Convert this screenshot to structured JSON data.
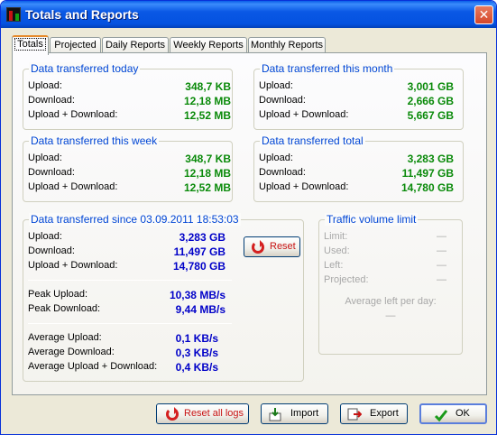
{
  "window": {
    "title": "Totals and Reports",
    "close": "✕"
  },
  "tabs": [
    {
      "label": "Totals"
    },
    {
      "label": "Projected"
    },
    {
      "label": "Daily Reports"
    },
    {
      "label": "Weekly Reports"
    },
    {
      "label": "Monthly Reports"
    }
  ],
  "today": {
    "title": "Data transferred today",
    "upload_label": "Upload:",
    "upload": "348,7 KB",
    "download_label": "Download:",
    "download": "12,18 MB",
    "both_label": "Upload + Download:",
    "both": "12,52 MB"
  },
  "month": {
    "title": "Data transferred this month",
    "upload_label": "Upload:",
    "upload": "3,001 GB",
    "download_label": "Download:",
    "download": "2,666 GB",
    "both_label": "Upload + Download:",
    "both": "5,667 GB"
  },
  "week": {
    "title": "Data transferred this week",
    "upload_label": "Upload:",
    "upload": "348,7 KB",
    "download_label": "Download:",
    "download": "12,18 MB",
    "both_label": "Upload + Download:",
    "both": "12,52 MB"
  },
  "total": {
    "title": "Data transferred total",
    "upload_label": "Upload:",
    "upload": "3,283 GB",
    "download_label": "Download:",
    "download": "11,497 GB",
    "both_label": "Upload + Download:",
    "both": "14,780 GB"
  },
  "since": {
    "title": "Data transferred since 03.09.2011 18:53:03",
    "upload_label": "Upload:",
    "upload": "3,283 GB",
    "download_label": "Download:",
    "download": "11,497 GB",
    "both_label": "Upload + Download:",
    "both": "14,780 GB",
    "peak_upload_label": "Peak Upload:",
    "peak_upload": "10,38 MB/s",
    "peak_download_label": "Peak Download:",
    "peak_download": "9,44 MB/s",
    "avg_upload_label": "Average Upload:",
    "avg_upload": "0,1 KB/s",
    "avg_download_label": "Average Download:",
    "avg_download": "0,3 KB/s",
    "avg_both_label": "Average Upload + Download:",
    "avg_both": "0,4 KB/s",
    "reset_label": "Reset"
  },
  "limit": {
    "title": "Traffic volume limit",
    "limit_label": "Limit:",
    "limit": "—",
    "used_label": "Used:",
    "used": "—",
    "left_label": "Left:",
    "left": "—",
    "projected_label": "Projected:",
    "projected": "—",
    "avg_left_label": "Average left per day:",
    "avg_left": "—"
  },
  "buttons": {
    "reset_all": "Reset all logs",
    "import": "Import",
    "export": "Export",
    "ok": "OK"
  },
  "colors": {
    "value_green": "#0a8a0a",
    "value_blue": "#0000c8",
    "title_blue": "#0046d5"
  }
}
